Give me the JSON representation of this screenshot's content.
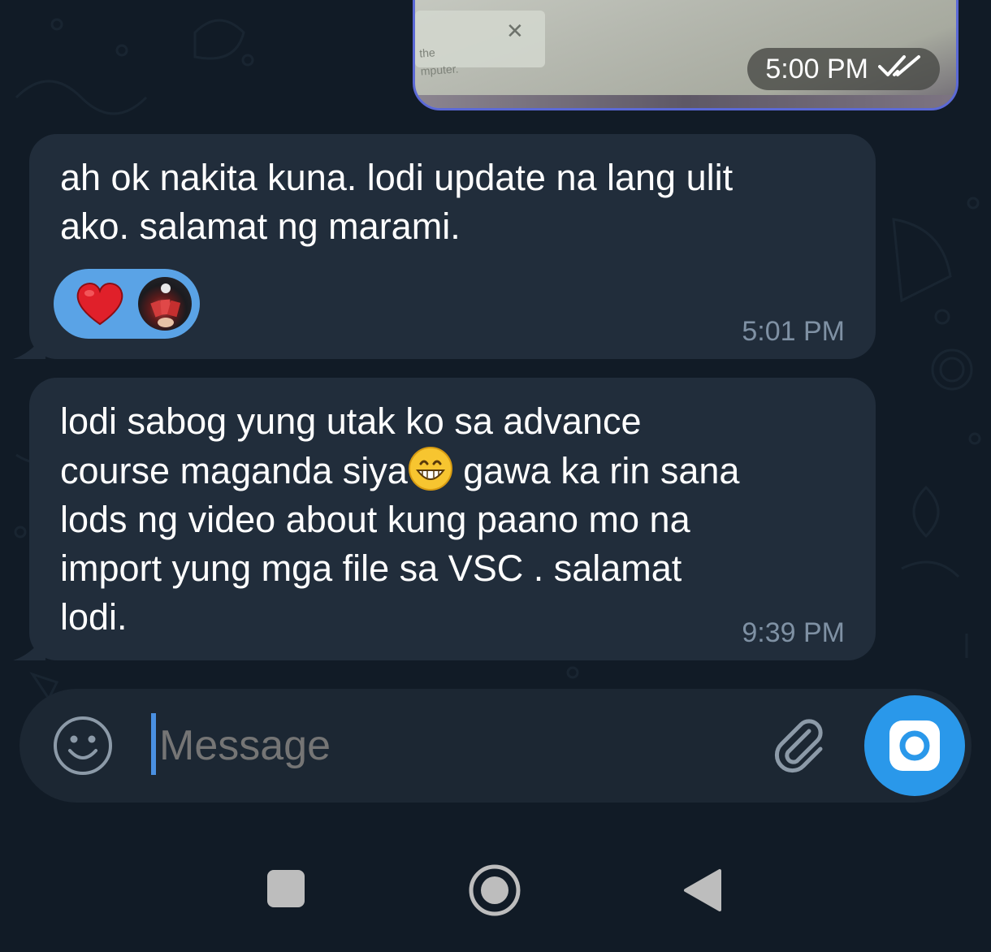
{
  "chat": {
    "media_message": {
      "thumb_text_line1": "the",
      "thumb_text_line2": "mputer.",
      "thumb_close_glyph": "✕",
      "time": "5:00 PM",
      "status_icon": "double-check-icon"
    },
    "messages": [
      {
        "text": "ah ok nakita kuna. lodi update na lang ulit\nako. salamat ng marami.",
        "time": "5:01 PM",
        "reaction": {
          "emoji_icon": "heart-icon",
          "avatar_icon": "reactor-avatar"
        }
      },
      {
        "text_before_emoji": "lodi sabog yung utak ko sa advance\ncourse maganda siya",
        "emoji_icon": "grinning-face-emoji",
        "text_after_emoji": " gawa ka rin sana\nlods ng video about kung paano mo na\nimport yung mga file sa VSC . salamat\nlodi.",
        "time": "9:39 PM"
      }
    ]
  },
  "composer": {
    "placeholder": "Message",
    "emoji_button_icon": "smiley-icon",
    "attach_button_icon": "paperclip-icon",
    "camera_button_icon": "camera-icon"
  },
  "nav": {
    "recents_icon": "square-icon",
    "home_icon": "circle-icon",
    "back_icon": "triangle-back-icon"
  },
  "colors": {
    "background": "#111b26",
    "incoming_bubble": "#212d3b",
    "outgoing_border": "#5b69d6",
    "reaction_pill": "#5aa3e6",
    "accent": "#2a98ea",
    "timestamp": "#7f91a4"
  }
}
